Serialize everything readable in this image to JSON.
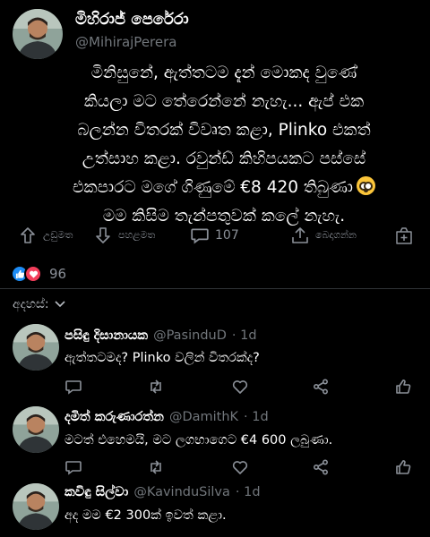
{
  "post": {
    "author_name": "මිහිරාජ් පෙරේරා",
    "author_handle": "@MihirajPerera",
    "lines": [
      "මිනිසුනේ, ඇත්තටම දැන් මොකද වුණේ",
      "කියලා මට තේරෙන්නේ නැහැ... ඇප් එක",
      "බලන්න විතරක් විවෘත කළා, Plinko එකත්",
      "උත්සාහ කළා. රවුන්ඩ් කිහිපයකට පස්සේ",
      "එකපාරට මගේ ගිණුමේ €8 420 තිබුණා",
      "මම කිසිම තැන්පතුවක් කලේ නැහැ."
    ],
    "emoji": "flushed-face-emoji"
  },
  "actions": {
    "upvote_label": "උඩුමත",
    "downvote_label": "පහළමත",
    "comment_count": "107",
    "share_label": "බෙදාගන්න"
  },
  "reactions": {
    "count": "96",
    "like_color": "#1d8cf5",
    "love_color": "#f33e5b"
  },
  "comments_section": {
    "label": "අදහස්:"
  },
  "comments": [
    {
      "name": "පසිඳු දිසානායක",
      "handle": "@PasinduD",
      "time": "· 1d",
      "text": "ඇත්තටමද? Plinko වලින් විතරක්ද?"
    },
    {
      "name": "දමිත් කරුණාරත්න",
      "handle": "@DamithK",
      "time": "· 1d",
      "text": "මටත් එහෙමයි, මට ලගභාගෙට €4 600 ලබුණා."
    },
    {
      "name": "කවිඳු සිල්වා",
      "handle": "@KavinduSilva",
      "time": "· 1d",
      "text": "අද මම €2 300ක් ඉවත් කළා."
    }
  ]
}
